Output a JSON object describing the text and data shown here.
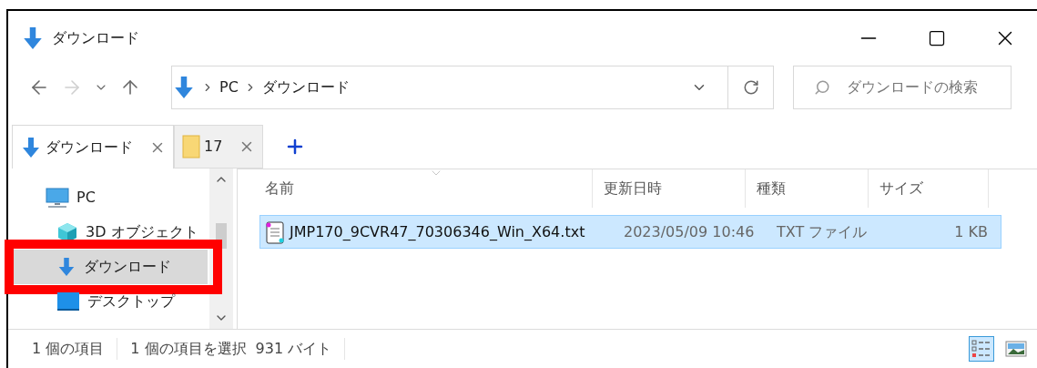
{
  "window": {
    "title": "ダウンロード"
  },
  "nav_buttons": [
    {
      "kind": "back",
      "disabled": false
    },
    {
      "kind": "forward",
      "disabled": true
    },
    {
      "kind": "recent",
      "disabled": false
    },
    {
      "kind": "up",
      "disabled": false
    }
  ],
  "address_bar": {
    "path": [
      "PC",
      "ダウンロード"
    ]
  },
  "search": {
    "placeholder": "ダウンロードの検索"
  },
  "tabs": [
    {
      "label": "ダウンロード",
      "kind": "download",
      "selected": true
    },
    {
      "label": "17",
      "kind": "folder",
      "selected": false
    }
  ],
  "sidebar": {
    "items": [
      {
        "label": "PC",
        "kind": "pc",
        "selected": false,
        "highlighted": false,
        "children": [
          {
            "label": "3D オブジェクト",
            "kind": "objects3d",
            "selected": false,
            "highlighted": false
          },
          {
            "label": "ダウンロード",
            "kind": "download",
            "selected": true,
            "highlighted": true
          },
          {
            "label": "デスクトップ",
            "kind": "desktop",
            "selected": false,
            "highlighted": false
          }
        ]
      }
    ]
  },
  "table": {
    "columns": [
      "名前",
      "更新日時",
      "種類",
      "サイズ"
    ],
    "rows": [
      {
        "kind": "txt",
        "selected": true,
        "cells": [
          "JMP170_9CVR47_70306346_Win_X64.txt",
          "2023/05/09 10:46",
          "TXT ファイル",
          "1 KB"
        ]
      }
    ]
  },
  "status_bar": {
    "items": [
      "1 個の項目",
      "1 個の項目を選択",
      "931 バイト"
    ]
  },
  "view_buttons": [
    {
      "kind": "details",
      "selected": true
    },
    {
      "kind": "large_icons",
      "selected": false
    }
  ]
}
